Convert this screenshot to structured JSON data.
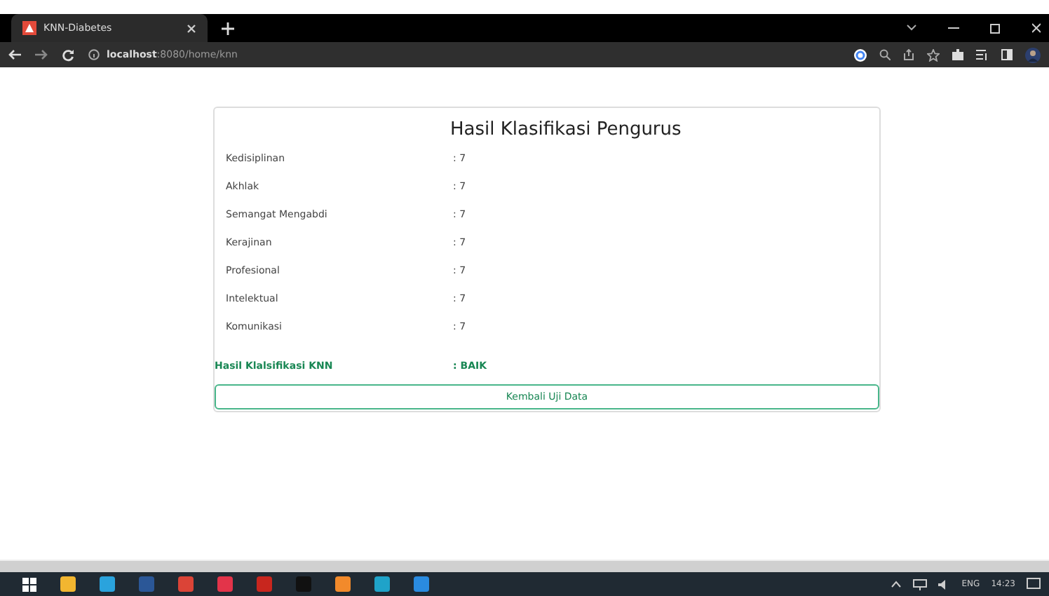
{
  "browser": {
    "tab_title": "KNN-Diabetes",
    "url_host": "localhost",
    "url_rest": ":8080/home/knn"
  },
  "card": {
    "title": "Hasil Klasifikasi Pengurus",
    "rows": [
      {
        "label": "Kedisiplinan",
        "value": ": 7"
      },
      {
        "label": "Akhlak",
        "value": ": 7"
      },
      {
        "label": "Semangat Mengabdi",
        "value": ": 7"
      },
      {
        "label": "Kerajinan",
        "value": ": 7"
      },
      {
        "label": "Profesional",
        "value": ": 7"
      },
      {
        "label": "Intelektual",
        "value": ": 7"
      },
      {
        "label": "Komunikasi",
        "value": ": 7"
      }
    ],
    "result": {
      "label": "Hasil Klalsifikasi KNN",
      "value": ": BAIK"
    },
    "button": "Kembali Uji Data"
  },
  "taskbar": {
    "language": "ENG",
    "time": "14:23"
  }
}
